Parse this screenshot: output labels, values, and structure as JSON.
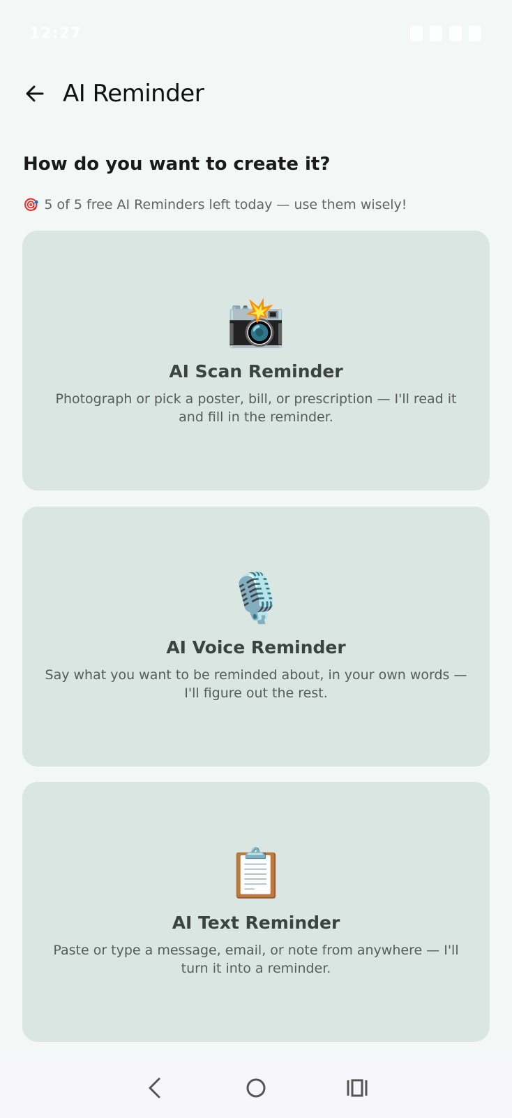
{
  "status_bar": {
    "time": "12:27"
  },
  "app_bar": {
    "title": "AI Reminder",
    "back_icon": "arrow-left-icon"
  },
  "section": {
    "heading": "How do you want to create it?",
    "quota_emoji": "🎯",
    "quota_text": "5 of 5 free AI Reminders left today — use them wisely!"
  },
  "options": [
    {
      "emoji": "📸",
      "icon": "camera-flash-icon",
      "title": "AI Scan Reminder",
      "description": "Photograph or pick a poster, bill, or prescription — I'll read it and fill in the reminder."
    },
    {
      "emoji": "🎙️",
      "icon": "microphone-icon",
      "title": "AI Voice Reminder",
      "description": "Say what you want to be reminded about, in your own words — I'll figure out the rest."
    },
    {
      "emoji": "📋",
      "icon": "clipboard-icon",
      "title": "AI Text Reminder",
      "description": "Paste or type a message, email, or note from anywhere — I'll turn it into a reminder."
    }
  ],
  "nav_bar": {
    "back": "back-icon",
    "home": "home-icon",
    "recents": "recents-icon"
  },
  "colors": {
    "background": "#f3f8f6",
    "card": "#dae6e2",
    "text": "#1c1c1c",
    "muted": "#5f6462"
  }
}
